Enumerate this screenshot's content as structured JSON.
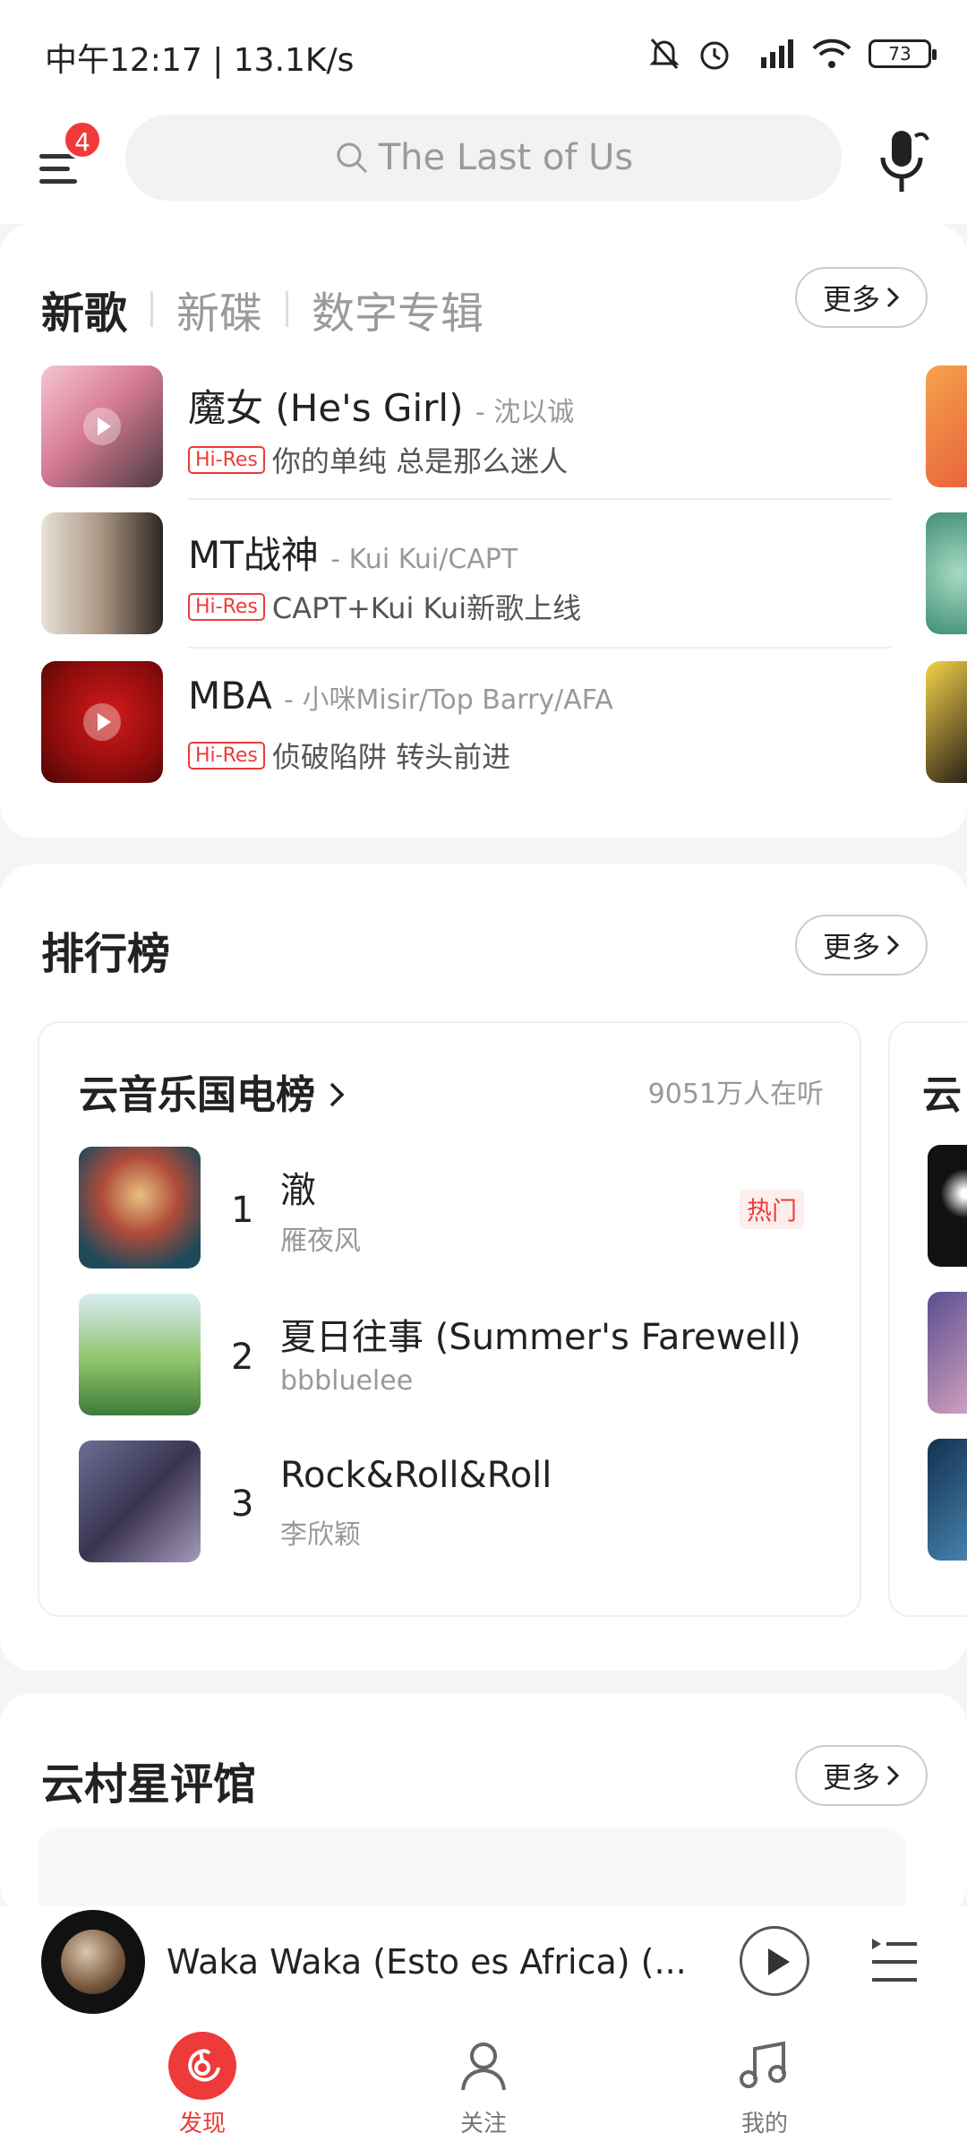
{
  "status_bar": {
    "time_and_speed": "中午12:17 | 13.1K/s",
    "battery": "73"
  },
  "top_bar": {
    "notification_count": "4",
    "search_placeholder": "The Last of Us"
  },
  "new_section": {
    "tabs": [
      "新歌",
      "新碟",
      "数字专辑"
    ],
    "more_label": "更多",
    "songs": [
      {
        "title": "魔女 (He's Girl)",
        "artist": "- 沈以诚",
        "badge": "Hi-Res",
        "desc": "你的单纯 总是那么迷人"
      },
      {
        "title": "MT战神",
        "artist": "- Kui Kui/CAPT",
        "badge": "Hi-Res",
        "desc": "CAPT+Kui Kui新歌上线"
      },
      {
        "title": "MBA",
        "artist": "- 小咪Misir/Top Barry/AFA",
        "badge": "Hi-Res",
        "desc": "侦破陷阱 转头前进"
      }
    ]
  },
  "chart_section": {
    "title": "排行榜",
    "more_label": "更多",
    "panel_title": "云音乐国电榜",
    "listeners": "9051万人在听",
    "next_panel_initial": "云",
    "tracks": [
      {
        "rank": "1",
        "title": "澈",
        "artist": "雁夜风",
        "tag": "热门"
      },
      {
        "rank": "2",
        "title": "夏日往事 (Summer's Farewell)",
        "artist": "bbbluelee",
        "tag": ""
      },
      {
        "rank": "3",
        "title": "Rock&Roll&Roll",
        "artist": "李欣颖",
        "tag": ""
      }
    ]
  },
  "review_section": {
    "title": "云村星评馆",
    "more_label": "更多"
  },
  "mini_player": {
    "title": "Waka Waka (Esto es Africa) (..."
  },
  "bottom_nav": [
    {
      "label": "发现",
      "icon": "discover-icon"
    },
    {
      "label": "关注",
      "icon": "follow-icon"
    },
    {
      "label": "我的",
      "icon": "music-note-icon"
    }
  ],
  "colors": {
    "accent": "#ef3a3a"
  }
}
